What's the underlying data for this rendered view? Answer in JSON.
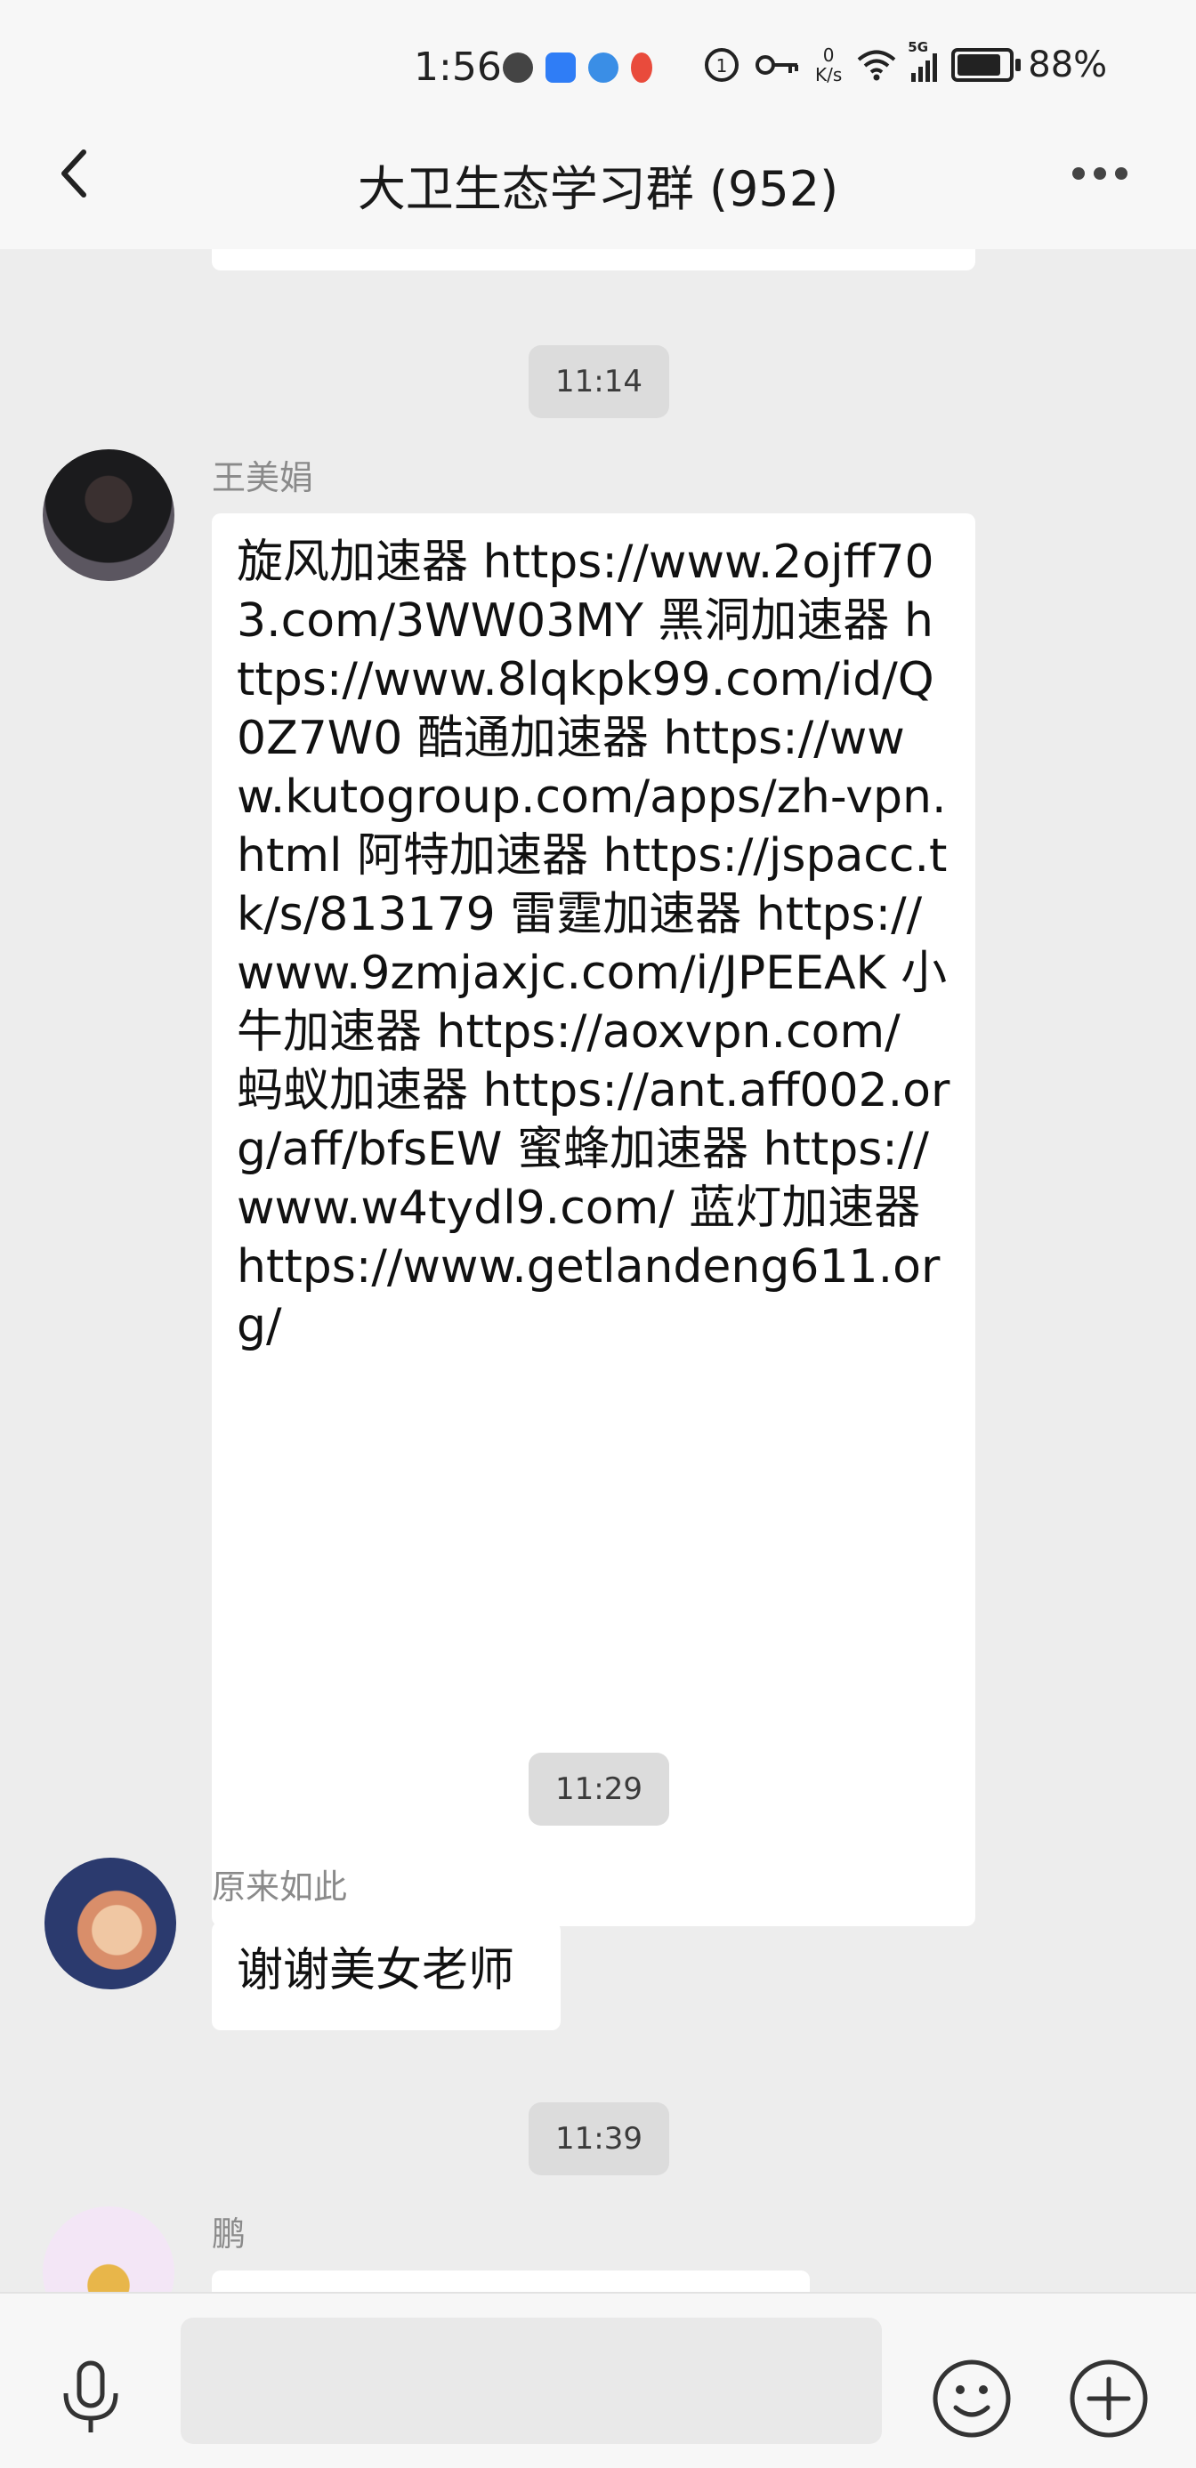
{
  "status_bar": {
    "time": "1:56",
    "net_speed_value": "0",
    "net_speed_unit": "K/s",
    "signal_label": "5G",
    "battery": "88%",
    "battery_level": 0.88
  },
  "header": {
    "title": "大卫生态学习群 (952)"
  },
  "messages": [
    {
      "time": "11:14",
      "sender": "王美娟",
      "text": "旋风加速器 https://www.2ojff703.com/3WW03MY 黑洞加速器 https://www.8lqkpk99.com/id/Q0Z7W0 酷通加速器 https://www.kutogroup.com/apps/zh-vpn.html 阿特加速器 https://jspacc.tk/s/813179 雷霆加速器 https://www.9zmjaxjc.com/i/JPEEAK 小牛加速器 https://aoxvpn.com/ 蚂蚁加速器 https://ant.aff002.org/aff/bfsEW 蜜蜂加速器 https://www.w4tydl9.com/ 蓝灯加速器 https://www.getlandeng611.org/"
    },
    {
      "time": "11:29",
      "sender": "原来如此",
      "text": "谢谢美女老师"
    },
    {
      "time": "11:39",
      "sender": "鹏",
      "text": ""
    }
  ],
  "input": {
    "placeholder": ""
  },
  "icons": {
    "back": "back-arrow-icon",
    "more": "more-dots-icon",
    "mic": "microphone-icon",
    "emoji": "emoji-icon",
    "plus": "plus-icon"
  },
  "colors": {
    "background": "#ededed",
    "bar": "#f7f7f7",
    "bubble": "#ffffff",
    "time_pill": "#dcdcdc"
  }
}
